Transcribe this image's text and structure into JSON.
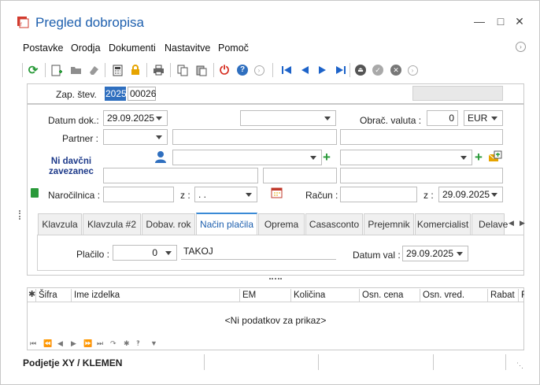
{
  "window": {
    "title": "Pregled dobropisa"
  },
  "menu": [
    "Postavke",
    "Orodja",
    "Dokumenti",
    "Nastavitve",
    "Pomoč"
  ],
  "toolbar": {
    "icons": [
      "refresh-icon",
      "new-document-icon",
      "open-folder-icon",
      "eraser-icon",
      "calculator-icon",
      "lock-icon",
      "print-icon",
      "copy-icon",
      "paste-icon",
      "power-icon",
      "help-icon",
      "forward-disabled-icon",
      "first-record-icon",
      "prev-record-icon",
      "next-record-icon",
      "last-record-icon",
      "eject-icon",
      "confirm-icon",
      "cancel-icon",
      "forward-icon"
    ]
  },
  "header": {
    "zap_label": "Zap. štev.",
    "zap_year": "2025",
    "zap_number": "00026"
  },
  "form": {
    "datum_label": "Datum dok.:",
    "datum_value": "29.09.2025",
    "obrac_label": "Obrač. valuta :",
    "obrac_value": "0",
    "currency": "EUR",
    "partner_label": "Partner :",
    "ni_davcni": "Ni davčni zavezanec",
    "narocilnica_label": "Naročilnica :",
    "z1_label": "z :",
    "z1_value": ". .",
    "racun_label": "Račun :",
    "z2_label": "z :",
    "z2_value": "29.09.2025"
  },
  "tabs": [
    "Klavzula",
    "Klavzula #2",
    "Dobav. rok",
    "Način plačila",
    "Oprema",
    "Casasconto",
    "Prejemnik",
    "Komercialist",
    "Delave"
  ],
  "active_tab": "Način plačila",
  "payment": {
    "placilo_label": "Plačilo :",
    "placilo_value": "0",
    "placilo_text": "TAKOJ",
    "datum_val_label": "Datum val :",
    "datum_val_value": "29.09.2025"
  },
  "grid": {
    "columns": [
      "Šifra",
      "Ime izdelka",
      "EM",
      "Količina",
      "Osn. cena",
      "Osn. vred.",
      "Rabat",
      "R"
    ],
    "empty": "<Ni podatkov za prikaz>"
  },
  "status": {
    "user": "Podjetje XY / KLEMEN"
  }
}
